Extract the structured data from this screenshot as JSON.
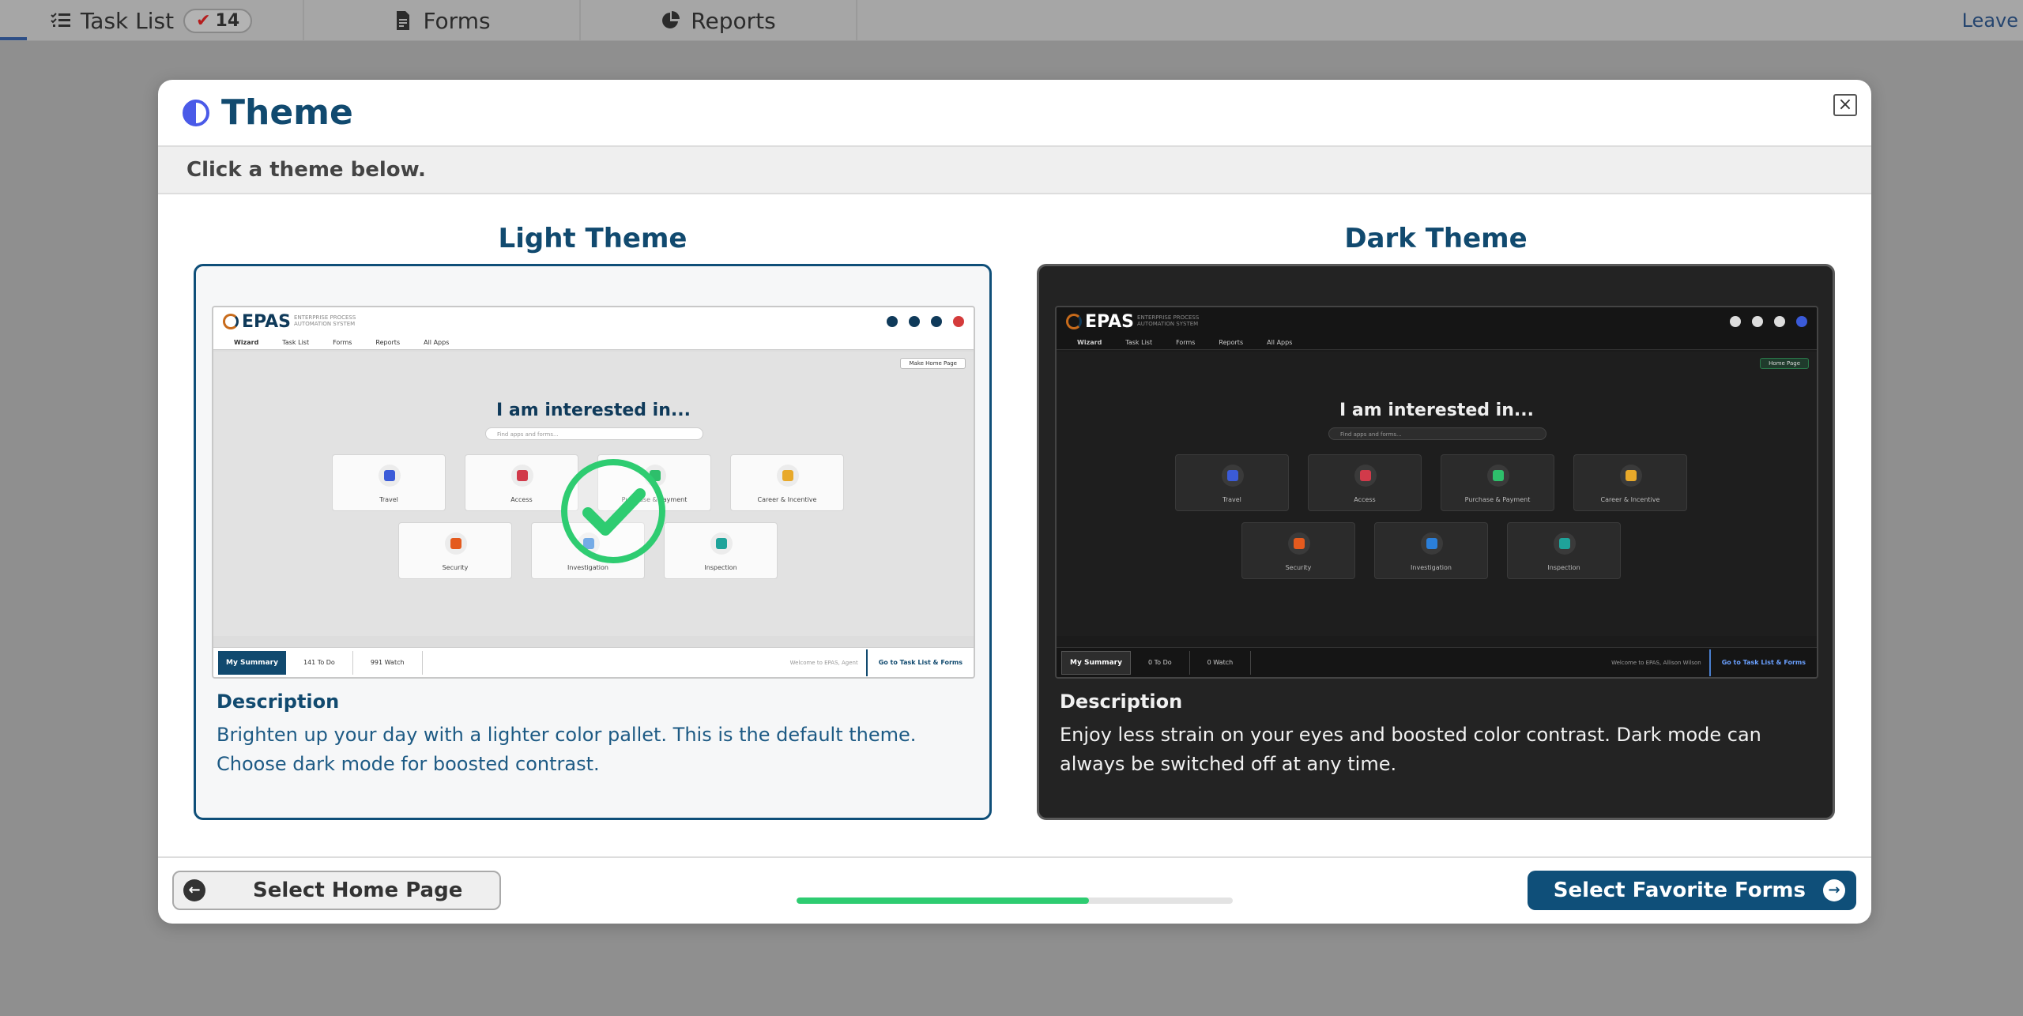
{
  "topnav": {
    "tabs": [
      {
        "label": "Task List",
        "icon": "task-list-icon",
        "badge": "14"
      },
      {
        "label": "Forms",
        "icon": "form-icon"
      },
      {
        "label": "Reports",
        "icon": "pie-chart-icon"
      }
    ],
    "leave": "Leave"
  },
  "modal": {
    "title": "Theme",
    "close": "×",
    "subtitle": "Click a theme below.",
    "themes": {
      "light": {
        "title": "Light Theme",
        "selected": true,
        "desc_heading": "Description",
        "desc_text": "Brighten up your day with a lighter color pallet. This is the default theme. Choose dark mode for boosted contrast.",
        "preview": {
          "logo": "EPAS",
          "logo_sub": "ENTERPRISE PROCESS AUTOMATION SYSTEM",
          "tabs": [
            "Wizard",
            "Task List",
            "Forms",
            "Reports",
            "All Apps"
          ],
          "headline": "I am interested in...",
          "search": "Find apps and forms...",
          "home_page": "Make Home Page",
          "tiles": [
            "Travel",
            "Access",
            "Purchase & Payment",
            "Career & Incentive",
            "Security",
            "Investigation",
            "Inspection"
          ],
          "summary": "My Summary",
          "todo": "141  To Do",
          "watch": "991  Watch",
          "welcome": "Welcome to EPAS, Agent",
          "goto": "Go to Task List & Forms"
        }
      },
      "dark": {
        "title": "Dark Theme",
        "selected": false,
        "desc_heading": "Description",
        "desc_text": "Enjoy less strain on your eyes and boosted color contrast. Dark mode can always be switched off at any time.",
        "preview": {
          "logo": "EPAS",
          "logo_sub": "ENTERPRISE PROCESS AUTOMATION SYSTEM",
          "tabs": [
            "Wizard",
            "Task List",
            "Forms",
            "Reports",
            "All Apps"
          ],
          "headline": "I am interested in...",
          "search": "Find apps and forms...",
          "home_page": "Home Page",
          "tiles": [
            "Travel",
            "Access",
            "Purchase & Payment",
            "Career & Incentive",
            "Security",
            "Investigation",
            "Inspection"
          ],
          "summary": "My Summary",
          "todo": "0  To Do",
          "watch": "0  Watch",
          "welcome": "Welcome to EPAS, Allison Wilson",
          "goto": "Go to Task List & Forms"
        }
      }
    },
    "footer": {
      "prev_label": "Select Home Page",
      "next_label": "Select Favorite Forms",
      "progress": 0.67
    }
  },
  "colors": {
    "brand": "#0f4f79",
    "progress": "#2ecc71",
    "badge_check": "#b51d1d"
  }
}
